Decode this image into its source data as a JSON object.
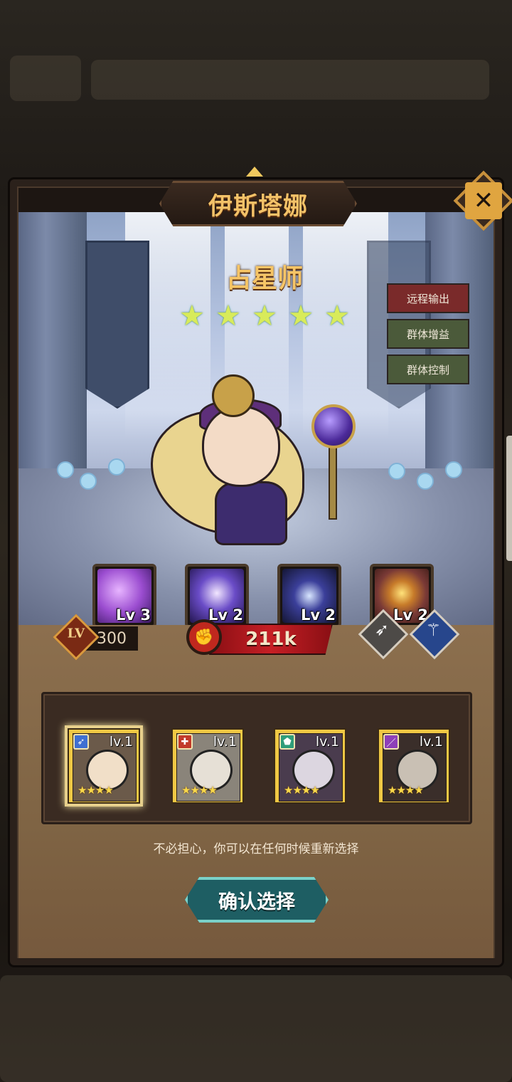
{
  "hero": {
    "name": "伊斯塔娜",
    "title": "占星师",
    "star_count": 5,
    "stars": [
      "★",
      "★",
      "★",
      "★",
      "★"
    ],
    "tags": [
      "远程输出",
      "群体增益",
      "群体控制"
    ],
    "level_label": "LV",
    "level": "300",
    "power": "211k",
    "class_icons": [
      "bow-icon",
      "staff-icon"
    ]
  },
  "skills": [
    {
      "level": "Lv 3",
      "icon": "nebula-skill-icon",
      "color": "#9b4dd0"
    },
    {
      "level": "Lv 2",
      "icon": "light-cross-skill-icon",
      "color": "#6a4cc7"
    },
    {
      "level": "Lv 2",
      "icon": "moon-star-skill-icon",
      "color": "#3b3f9a"
    },
    {
      "level": "Lv 2",
      "icon": "lightning-skill-icon",
      "color": "#7a3a36"
    }
  ],
  "choices": [
    {
      "level": "lv.1",
      "stars": "★★★★",
      "class_icon": "bow-icon",
      "class_color": "#3f6fd1",
      "selected": true
    },
    {
      "level": "lv.1",
      "stars": "★★★★",
      "class_icon": "plus-icon",
      "class_color": "#c23a2a",
      "selected": false
    },
    {
      "level": "lv.1",
      "stars": "★★★★",
      "class_icon": "shield-icon",
      "class_color": "#2f9d7a",
      "selected": false
    },
    {
      "level": "lv.1",
      "stars": "★★★★",
      "class_icon": "blade-icon",
      "class_color": "#8d3fb8",
      "selected": false
    }
  ],
  "hint": "不必担心，你可以在任何时候重新选择",
  "confirm_label": "确认选择",
  "close_label": "✕",
  "colors": {
    "accent": "#f3c268",
    "power_red": "#c61f25",
    "confirm": "#1e5e63"
  }
}
